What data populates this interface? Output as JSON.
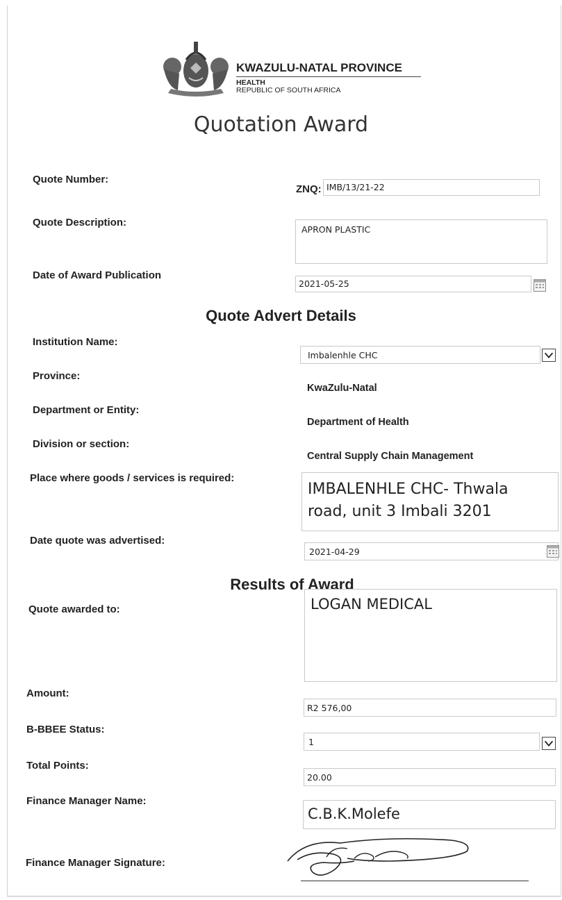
{
  "header": {
    "province": "KWAZULU-NATAL PROVINCE",
    "dept": "HEALTH",
    "country": "REPUBLIC OF SOUTH AFRICA"
  },
  "title": "Quotation Award",
  "quote": {
    "number_label": "Quote Number:",
    "number_prefix": "ZNQ:",
    "number_value": "IMB/13/21-22",
    "description_label": "Quote Description:",
    "description_value": "APRON PLASTIC",
    "award_date_label": "Date of Award Publication",
    "award_date_value": "2021-05-25"
  },
  "advert": {
    "section_title": "Quote Advert Details",
    "institution_label": "Institution Name:",
    "institution_value": "Imbalenhle CHC",
    "province_label": "Province:",
    "province_value": "KwaZulu-Natal",
    "department_label": "Department or Entity:",
    "department_value": "Department of Health",
    "division_label": "Division or section:",
    "division_value": "Central Supply Chain Management",
    "place_label": "Place where goods /  services is required:",
    "place_value": "IMBALENHLE CHC- Thwala road, unit 3 Imbali 3201",
    "advertised_label": "Date quote was advertised:",
    "advertised_value": "2021-04-29"
  },
  "results": {
    "section_title": "Results of Award",
    "awarded_label": "Quote awarded to:",
    "awarded_value": "LOGAN MEDICAL",
    "amount_label": "Amount:",
    "amount_value": "R2 576,00",
    "bbbee_label": "B-BBEE Status:",
    "bbbee_value": "1",
    "points_label": "Total Points:",
    "points_value": "20.00",
    "fm_name_label": "Finance Manager Name:",
    "fm_name_value": "C.B.K.Molefe",
    "fm_signature_label": "Finance Manager Signature:"
  },
  "icons": {
    "calendar": "calendar-icon",
    "dropdown": "chevron-down-icon",
    "crest": "coat-of-arms-icon",
    "signature": "signature-scribble"
  }
}
